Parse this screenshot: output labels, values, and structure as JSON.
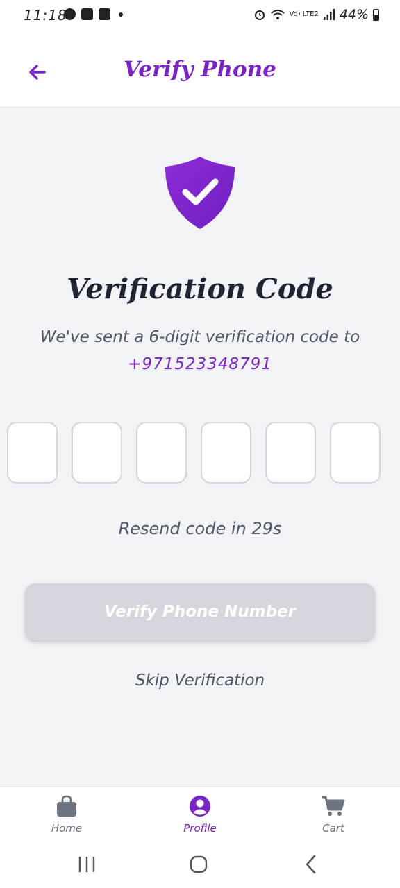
{
  "status_bar": {
    "time": "11:18",
    "battery_text": "44%",
    "network_text": "Vo) LTE2"
  },
  "header": {
    "title": "Verify Phone",
    "back_icon": "arrow-left-icon"
  },
  "main": {
    "shield_icon": "shield-check-icon",
    "heading": "Verification Code",
    "subtext": "We've sent a 6-digit verification code to",
    "phone_number": "+971523348791",
    "otp_count": 6,
    "resend_text": "Resend code in 29s",
    "verify_button_label": "Verify Phone Number",
    "skip_label": "Skip Verification"
  },
  "bottom_nav": {
    "items": [
      {
        "label": "Home",
        "icon": "shopping-bag-icon",
        "active": false
      },
      {
        "label": "Profile",
        "icon": "user-circle-icon",
        "active": true
      },
      {
        "label": "Cart",
        "icon": "cart-icon",
        "active": false
      }
    ]
  },
  "colors": {
    "accent": "#7b22c9",
    "background": "#f2f3f6",
    "disabled_button": "#d6d7de",
    "heading": "#1e2433",
    "muted_text": "#4b5563"
  }
}
